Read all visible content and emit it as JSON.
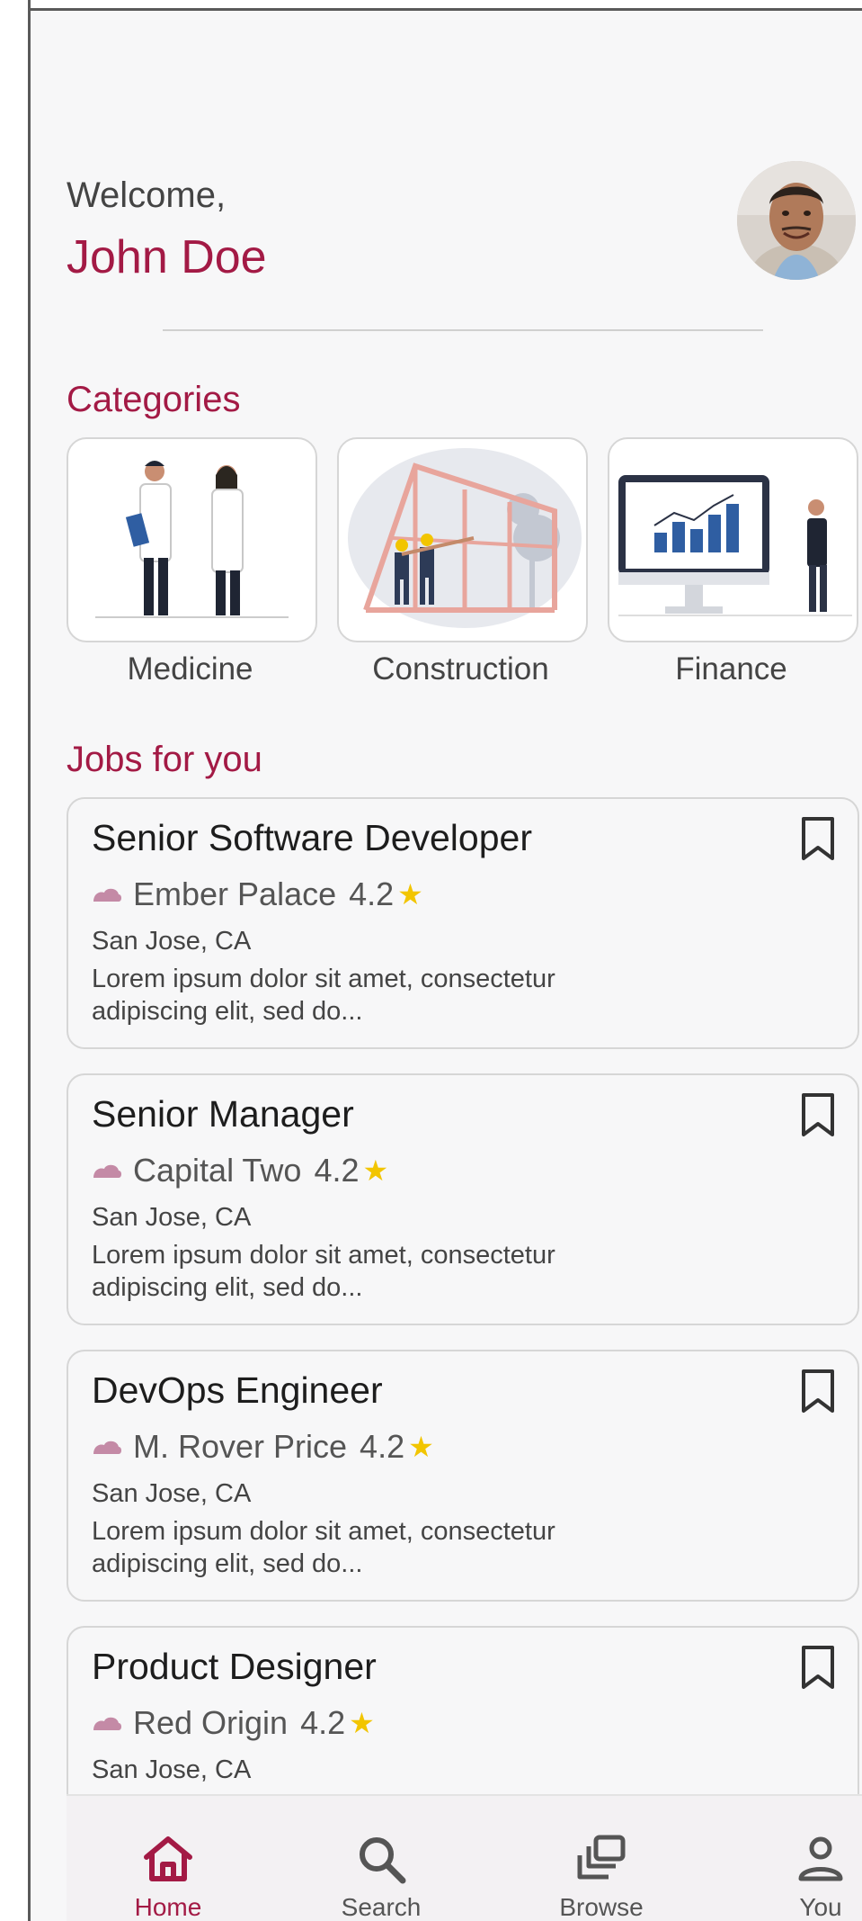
{
  "header": {
    "greeting": "Welcome,",
    "user_name": "John Doe"
  },
  "categories": {
    "title": "Categories",
    "items": [
      {
        "label": "Medicine"
      },
      {
        "label": "Construction"
      },
      {
        "label": "Finance"
      }
    ]
  },
  "jobs": {
    "title": "Jobs for you",
    "items": [
      {
        "title": "Senior Software Developer",
        "company": "Ember Palace",
        "rating": "4.2",
        "location": "San Jose, CA",
        "description": "Lorem ipsum dolor sit amet, consectetur adipiscing elit, sed do..."
      },
      {
        "title": "Senior Manager",
        "company": "Capital Two",
        "rating": "4.2",
        "location": "San Jose, CA",
        "description": "Lorem ipsum dolor sit amet, consectetur adipiscing elit, sed do..."
      },
      {
        "title": "DevOps Engineer",
        "company": "M. Rover Price",
        "rating": "4.2",
        "location": "San Jose, CA",
        "description": "Lorem ipsum dolor sit amet, consectetur adipiscing elit, sed do..."
      },
      {
        "title": "Product Designer",
        "company": "Red Origin",
        "rating": "4.2",
        "location": "San Jose, CA"
      }
    ]
  },
  "bottom_nav": {
    "items": [
      {
        "label": "Home",
        "icon": "home-icon",
        "active": true
      },
      {
        "label": "Search",
        "icon": "search-icon",
        "active": false
      },
      {
        "label": "Browse",
        "icon": "browse-icon",
        "active": false
      },
      {
        "label": "You",
        "icon": "person-icon",
        "active": false
      }
    ]
  },
  "colors": {
    "accent": "#a31a45",
    "star": "#f2c500",
    "company_cloud": "#c48aa6",
    "background": "#f7f7f8"
  }
}
